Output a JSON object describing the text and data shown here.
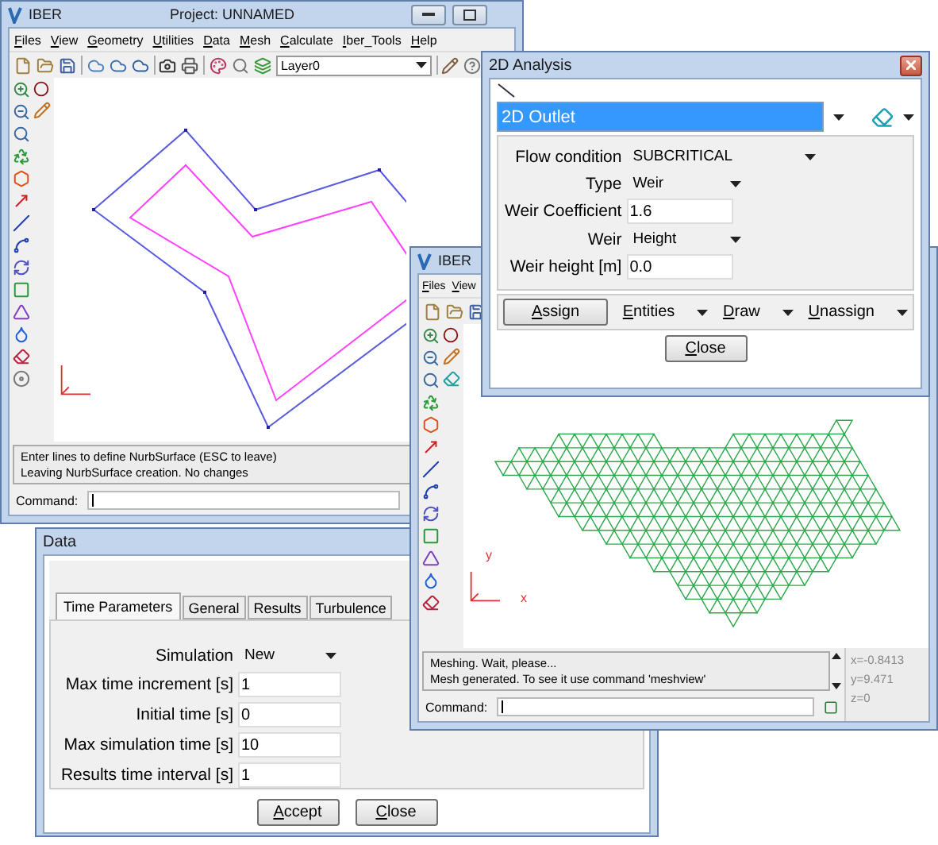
{
  "main_window": {
    "title": "IBER",
    "project": "Project: UNNAMED",
    "menu": [
      "Files",
      "View",
      "Geometry",
      "Utilities",
      "Data",
      "Mesh",
      "Calculate",
      "Iber_Tools",
      "Help"
    ],
    "layer": "Layer0",
    "messages": [
      "Enter lines to define NurbSurface (ESC to leave)",
      "Leaving NurbSurface creation. No changes"
    ],
    "command_label": "Command:"
  },
  "data_window": {
    "title": "Data",
    "tabs": [
      {
        "label": "Time Parameters",
        "selected": true
      },
      {
        "label": "General",
        "selected": false
      },
      {
        "label": "Results",
        "selected": false
      },
      {
        "label": "Turbulence",
        "selected": false
      }
    ],
    "fields": [
      {
        "label": "Simulation",
        "value": "New",
        "kind": "select"
      },
      {
        "label": "Max time increment [s]",
        "value": "1",
        "kind": "input"
      },
      {
        "label": "Initial time [s]",
        "value": "0",
        "kind": "input"
      },
      {
        "label": "Max simulation time [s]",
        "value": "10",
        "kind": "input"
      },
      {
        "label": "Results time interval [s]",
        "value": "1",
        "kind": "input"
      }
    ],
    "buttons": [
      "Accept",
      "Close"
    ]
  },
  "mesh_window": {
    "title": "IBER",
    "menu": [
      "Files",
      "View"
    ],
    "axis_labels": [
      "x",
      "y"
    ],
    "messages": [
      "Meshing. Wait, please...",
      "Mesh generated. To see it use command 'meshview'"
    ],
    "coordinates": [
      "x=-0.8413",
      "y=9.471",
      "z=0"
    ],
    "command_label": "Command:"
  },
  "analysis_dialog": {
    "title": "2D Analysis",
    "condition": "2D Outlet",
    "fields": [
      {
        "label": "Flow condition",
        "value": "SUBCRITICAL",
        "kind": "select"
      },
      {
        "label": "Type",
        "value": "Weir",
        "kind": "select"
      },
      {
        "label": "Weir Coefficient",
        "value": "1.6",
        "kind": "input"
      },
      {
        "label": "Weir",
        "value": "Height",
        "kind": "select"
      },
      {
        "label": "Weir height [m]",
        "value": "0.0",
        "kind": "input"
      }
    ],
    "actions": [
      {
        "label": "Assign",
        "kind": "button"
      },
      {
        "label": "Entities",
        "kind": "menu"
      },
      {
        "label": "Draw",
        "kind": "menu"
      },
      {
        "label": "Unassign",
        "kind": "menu"
      }
    ],
    "close": "Close"
  }
}
